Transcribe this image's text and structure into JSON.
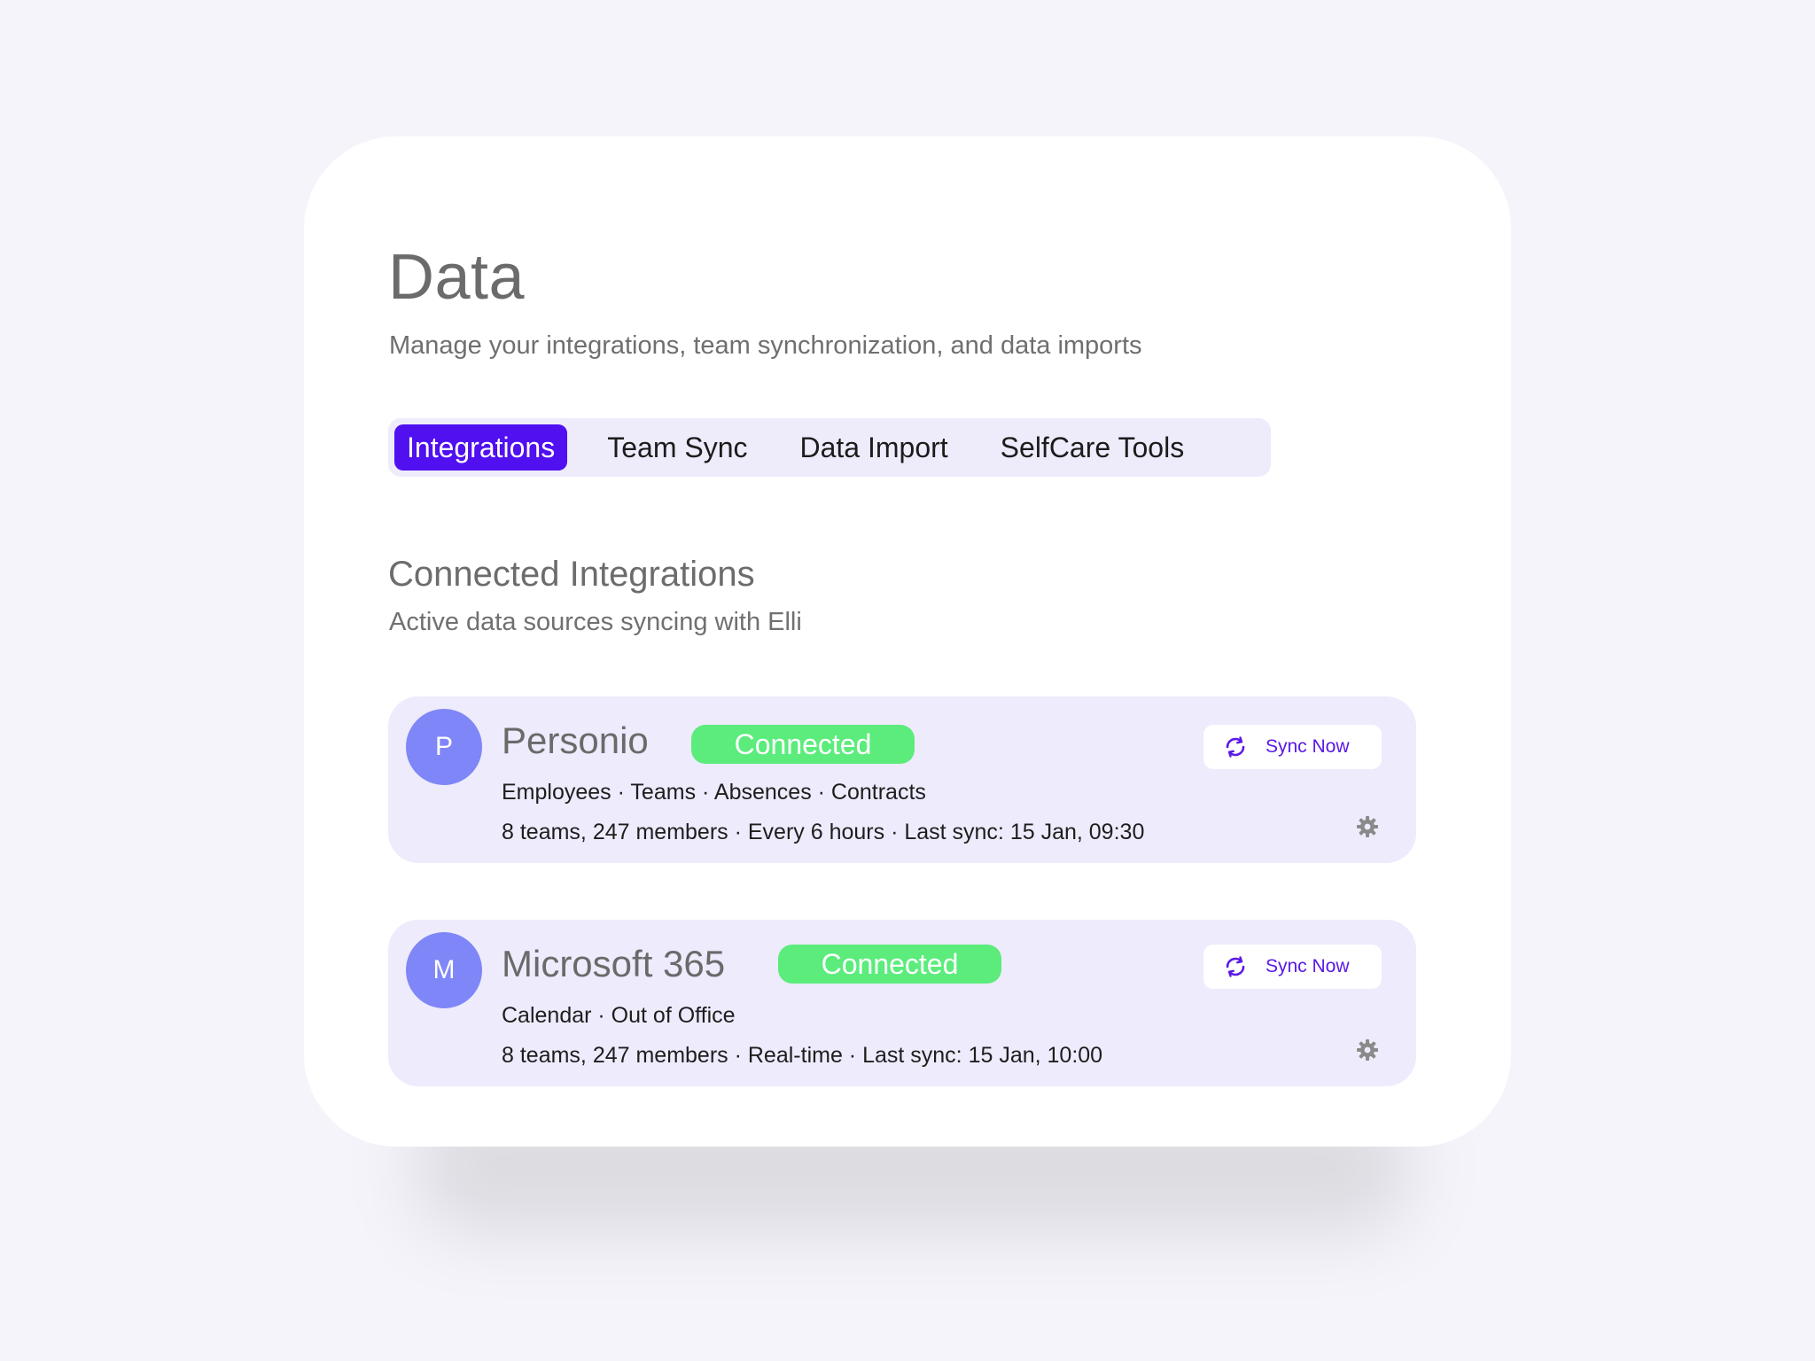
{
  "page": {
    "title": "Data",
    "subtitle": "Manage your integrations, team synchronization, and data imports"
  },
  "tabs": [
    {
      "label": "Integrations",
      "active": true
    },
    {
      "label": "Team Sync",
      "active": false
    },
    {
      "label": "Data Import",
      "active": false
    },
    {
      "label": "SelfCare Tools",
      "active": false
    }
  ],
  "section": {
    "title": "Connected Integrations",
    "subtitle": "Active data sources syncing with Elli"
  },
  "integrations": [
    {
      "avatar": "P",
      "name": "Personio",
      "status": "Connected",
      "scope": "Employees · Teams · Absences · Contracts",
      "meta": "8 teams, 247 members · Every 6 hours · Last sync: 15 Jan, 09:30",
      "sync_label": "Sync Now",
      "sync_icon": "sync-icon",
      "settings_icon": "gear-icon"
    },
    {
      "avatar": "M",
      "name": "Microsoft 365",
      "status": "Connected",
      "scope": "Calendar · Out of Office",
      "meta": "8 teams, 247 members · Real-time · Last sync: 15 Jan, 10:00",
      "sync_label": "Sync Now",
      "sync_icon": "sync-icon",
      "settings_icon": "gear-icon"
    }
  ],
  "colors": {
    "accent": "#5010f0",
    "connected": "#5bec7c",
    "avatar": "#7f86f7",
    "card_bg": "#eeebfc"
  }
}
